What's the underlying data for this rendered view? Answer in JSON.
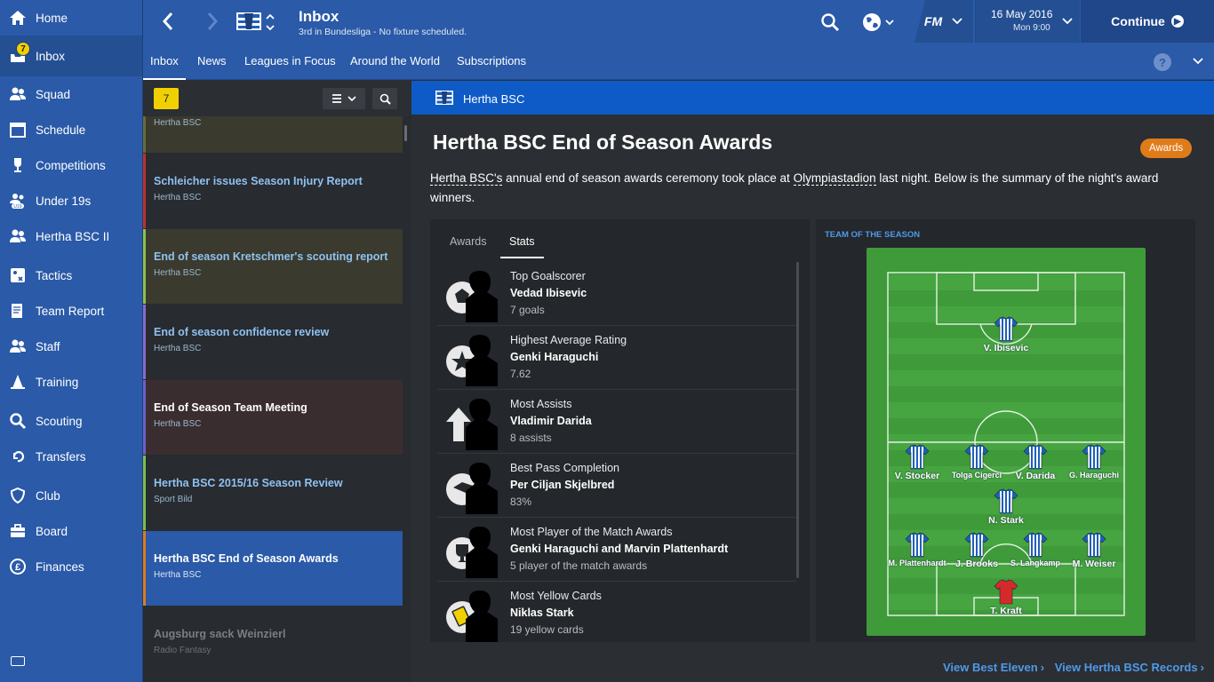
{
  "sidebar": {
    "items": [
      {
        "label": "Home",
        "icon": "home-icon"
      },
      {
        "label": "Inbox",
        "icon": "inbox-icon",
        "badge": "7"
      },
      {
        "label": "Squad",
        "icon": "squad-icon"
      },
      {
        "label": "Schedule",
        "icon": "calendar-icon"
      },
      {
        "label": "Competitions",
        "icon": "trophy-icon"
      },
      {
        "label": "Under 19s",
        "icon": "youth-icon",
        "badge_text": "U19"
      },
      {
        "label": "Hertha BSC II",
        "icon": "reserve-team-icon"
      },
      {
        "label": "Tactics",
        "icon": "tactics-board-icon"
      },
      {
        "label": "Team Report",
        "icon": "report-icon"
      },
      {
        "label": "Staff",
        "icon": "staff-icon"
      },
      {
        "label": "Training",
        "icon": "cone-icon"
      },
      {
        "label": "Scouting",
        "icon": "magnifier-icon"
      },
      {
        "label": "Transfers",
        "icon": "transfers-icon"
      },
      {
        "label": "Club",
        "icon": "shield-icon"
      },
      {
        "label": "Board",
        "icon": "briefcase-icon"
      },
      {
        "label": "Finances",
        "icon": "pound-icon"
      }
    ]
  },
  "header": {
    "title": "Inbox",
    "subtitle": "3rd in Bundesliga - No fixture scheduled.",
    "fm_label": "FM",
    "date": "16 May 2016",
    "time": "Mon 9:00",
    "continue_label": "Continue"
  },
  "subnav": {
    "tabs": [
      "Inbox",
      "News",
      "Leagues in Focus",
      "Around the World",
      "Subscriptions"
    ],
    "help": "?"
  },
  "message_list": {
    "unread_count": "7",
    "messages": [
      {
        "title": "",
        "from": "Hertha BSC",
        "accent": "#6a6a3a"
      },
      {
        "title": "Schleicher issues Season Injury Report",
        "from": "Hertha BSC",
        "accent": "#c0302a"
      },
      {
        "title": "End of season Kretschmer's scouting report",
        "from": "Hertha BSC",
        "accent": "#8cc04a"
      },
      {
        "title": "End of season confidence review",
        "from": "Hertha BSC",
        "accent": "#8a6ac8"
      },
      {
        "title": "End of Season Team Meeting",
        "from": "Hertha BSC",
        "accent": "#6a60c8"
      },
      {
        "title": "Hertha BSC 2015/16 Season Review",
        "from": "Sport Bild",
        "accent": "#7ac04a"
      },
      {
        "title": "Hertha BSC End of Season Awards",
        "from": "Hertha BSC",
        "accent": "#e07b1a"
      },
      {
        "title": "Augsburg sack Weinzierl",
        "from": "Radio Fantasy",
        "accent": "#282b30"
      }
    ]
  },
  "article": {
    "club": "Hertha BSC",
    "title": "Hertha BSC End of Season Awards",
    "tag": "Awards",
    "body_club": "Hertha BSC's",
    "body_part1": " annual end of season awards ceremony took place at ",
    "body_venue": "Olympiastadion",
    "body_part2": " last night. Below is the summary of the night's award winners."
  },
  "awards": {
    "tabs": [
      "Awards",
      "Stats"
    ],
    "active_tab": "Stats",
    "rows": [
      {
        "category": "Top Goalscorer",
        "winner": "Vedad Ibisevic",
        "value": "7 goals",
        "icon": "football-icon"
      },
      {
        "category": "Highest Average Rating",
        "winner": "Genki Haraguchi",
        "value": "7.62",
        "icon": "star-icon"
      },
      {
        "category": "Most Assists",
        "winner": "Vladimir Darida",
        "value": "8 assists",
        "icon": "assist-arrow-icon"
      },
      {
        "category": "Best Pass Completion",
        "winner": "Per Ciljan Skjelbred",
        "value": "83%",
        "icon": "pass-icon"
      },
      {
        "category": "Most Player of the Match Awards",
        "winner": "Genki Haraguchi and Marvin Plattenhardt",
        "value": "5 player of the match awards",
        "icon": "trophy-cup-icon"
      },
      {
        "category": "Most Yellow Cards",
        "winner": "Niklas Stark",
        "value": "19 yellow cards",
        "icon": "yellow-card-icon"
      }
    ]
  },
  "team_of_season": {
    "label": "TEAM OF THE SEASON",
    "players": [
      {
        "name": "V. Ibisevic",
        "role": "striker"
      },
      {
        "name": "V. Stocker",
        "role": "midfield"
      },
      {
        "name": "Tolga Cigerci",
        "role": "midfield"
      },
      {
        "name": "V. Darida",
        "role": "midfield"
      },
      {
        "name": "G. Haraguchi",
        "role": "midfield"
      },
      {
        "name": "N. Stark",
        "role": "defensive-midfield"
      },
      {
        "name": "M. Plattenhardt",
        "role": "defence"
      },
      {
        "name": "J. Brooks",
        "role": "defence"
      },
      {
        "name": "S. Langkamp",
        "role": "defence"
      },
      {
        "name": "M. Weiser",
        "role": "defence"
      },
      {
        "name": "T. Kraft",
        "role": "goalkeeper"
      }
    ],
    "kit_colors": {
      "outfield": "#1f5fb8",
      "goalkeeper": "#d42a2a"
    }
  },
  "footer_links": {
    "best_eleven": "View Best Eleven",
    "records": "View Hertha BSC Records"
  },
  "colors": {
    "primary": "#2a5aa8",
    "club_bar": "#0e5bc8",
    "accent_orange": "#e07b1a",
    "link": "#4e9ae8",
    "pitch": "#3f9a3a"
  }
}
